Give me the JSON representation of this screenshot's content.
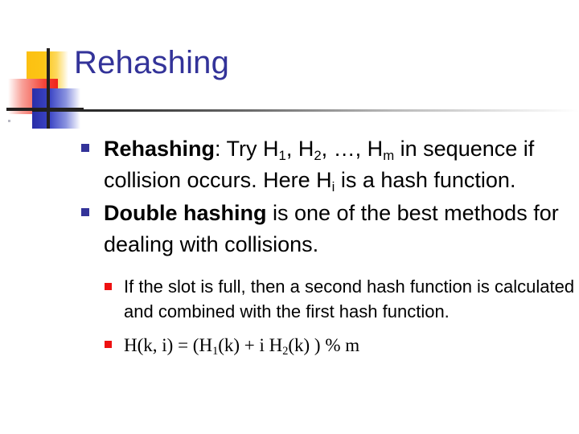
{
  "slide": {
    "title": "Rehashing",
    "title_color": "#333399",
    "bullet_color": "#333399",
    "subbullet_color": "#ee1111",
    "bullets": [
      {
        "lead": "Rehashing",
        "lead_bold": true,
        "text_before_sub1": ": Try H",
        "sub1": "1",
        "mid1": ", H",
        "sub2": "2",
        "mid2": ", …, H",
        "sub3": "m",
        "tail": " in sequence if collision occurs. Here H",
        "sub4": "i",
        "tail2": " is a hash function."
      },
      {
        "lead": "Double hashing",
        "lead_bold": true,
        "tail": " is one of the best methods for dealing with collisions."
      }
    ],
    "subbullets": [
      {
        "text": "If the slot is full, then a second hash function is calculated and combined with the first hash function."
      },
      {
        "formula_p1": "H(k, i) = (H",
        "formula_s1": "1",
        "formula_p2": "(k)  + i H",
        "formula_s2": "2",
        "formula_p3": "(k) ) % m"
      }
    ]
  }
}
